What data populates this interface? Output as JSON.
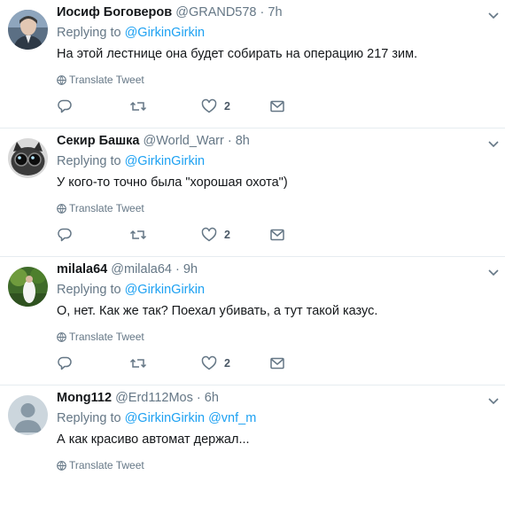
{
  "tweets": [
    {
      "fullname": "Иосиф Боговеров",
      "handle": "@GRAND578",
      "sep": "·",
      "time": "7h",
      "replying_prefix": "Replying to",
      "replying_to": "@GirkinGirkin",
      "replying_to_2": "",
      "text": "На этой лестнице она будет собирать на операцию 217 зим.",
      "translate": "Translate Tweet",
      "likes": "2"
    },
    {
      "fullname": "Секир Башка",
      "handle": "@World_Warr",
      "sep": "·",
      "time": "8h",
      "replying_prefix": "Replying to",
      "replying_to": "@GirkinGirkin",
      "replying_to_2": "",
      "text": "У кого-то точно была \"хорошая охота\")",
      "translate": "Translate Tweet",
      "likes": "2"
    },
    {
      "fullname": "milala64",
      "handle": "@milala64",
      "sep": "·",
      "time": "9h",
      "replying_prefix": "Replying to",
      "replying_to": "@GirkinGirkin",
      "replying_to_2": "",
      "text": "О, нет. Как же так? Поехал убивать, а тут такой казус.",
      "translate": "Translate Tweet",
      "likes": "2"
    },
    {
      "fullname": "Mong112",
      "handle": "@Erd112Mos",
      "sep": "·",
      "time": "6h",
      "replying_prefix": "Replying to",
      "replying_to": "@GirkinGirkin",
      "replying_to_2": "@vnf_m",
      "text": "А как красиво автомат держал...",
      "translate": "Translate Tweet",
      "likes": ""
    }
  ],
  "icons": {
    "caret": "chevron-down-icon",
    "reply": "reply-icon",
    "retweet": "retweet-icon",
    "like": "heart-icon",
    "dm": "envelope-icon",
    "translate": "globe-icon"
  },
  "colors": {
    "link": "#1da1f2",
    "secondary": "#657786",
    "text": "#14171a",
    "divider": "#e6ecf0"
  }
}
